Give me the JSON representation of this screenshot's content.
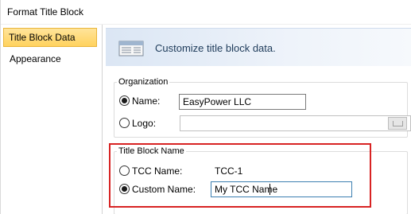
{
  "window": {
    "title": "Format Title Block"
  },
  "nav": {
    "items": [
      {
        "label": "Title Block Data",
        "selected": true
      },
      {
        "label": "Appearance",
        "selected": false
      }
    ]
  },
  "header": {
    "text": "Customize title block data.",
    "icon": "title-block-icon"
  },
  "organization": {
    "group_label": "Organization",
    "name_option": {
      "label": "Name:",
      "checked": true,
      "value": "EasyPower LLC"
    },
    "logo_option": {
      "label": "Logo:",
      "checked": false,
      "value": ""
    }
  },
  "title_block_name": {
    "group_label": "Title Block Name",
    "tcc_option": {
      "label": "TCC Name:",
      "checked": false,
      "value": "TCC-1"
    },
    "custom_option": {
      "label": "Custom Name:",
      "checked": true,
      "value": "My TCC Name"
    }
  },
  "colors": {
    "selection": "#ffd25e",
    "highlight": "#d82323",
    "header_text": "#1e3b5a"
  }
}
